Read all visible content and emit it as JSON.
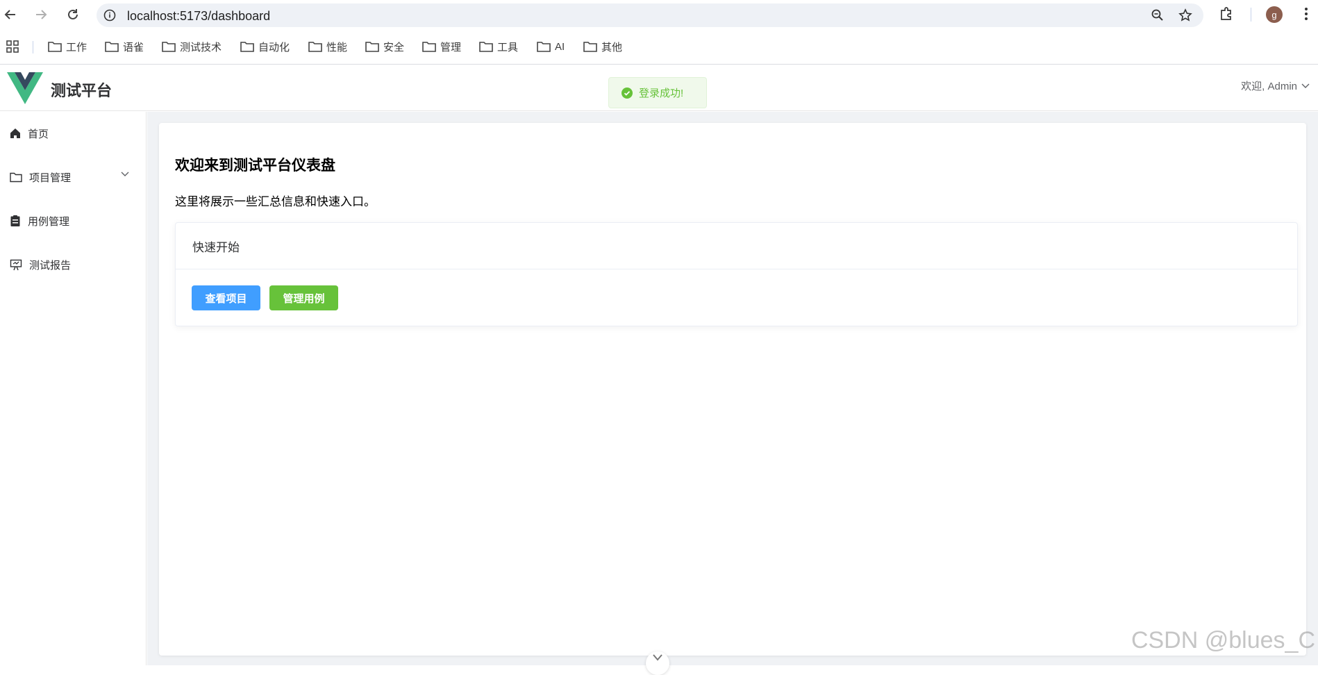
{
  "browser": {
    "url": "localhost:5173/dashboard",
    "profile_initial": "g",
    "bookmarks": [
      "工作",
      "语雀",
      "测试技术",
      "自动化",
      "性能",
      "安全",
      "管理",
      "工具",
      "AI",
      "其他"
    ]
  },
  "header": {
    "title": "测试平台",
    "user_greeting": "欢迎, Admin"
  },
  "toast": {
    "message": "登录成功!"
  },
  "sidebar": {
    "items": [
      {
        "label": "首页",
        "icon": "home-icon"
      },
      {
        "label": "项目管理",
        "icon": "folder-icon"
      },
      {
        "label": "用例管理",
        "icon": "clipboard-icon"
      },
      {
        "label": "测试报告",
        "icon": "presentation-icon"
      }
    ]
  },
  "main": {
    "heading": "欢迎来到测试平台仪表盘",
    "description": "这里将展示一些汇总信息和快速入口。",
    "quick_start": {
      "title": "快速开始",
      "view_projects_label": "查看项目",
      "manage_cases_label": "管理用例"
    }
  },
  "watermark": "CSDN @blues_C",
  "colors": {
    "primary": "#409eff",
    "success": "#67c23a",
    "logo_green": "#41b883",
    "logo_dark": "#35495e"
  }
}
